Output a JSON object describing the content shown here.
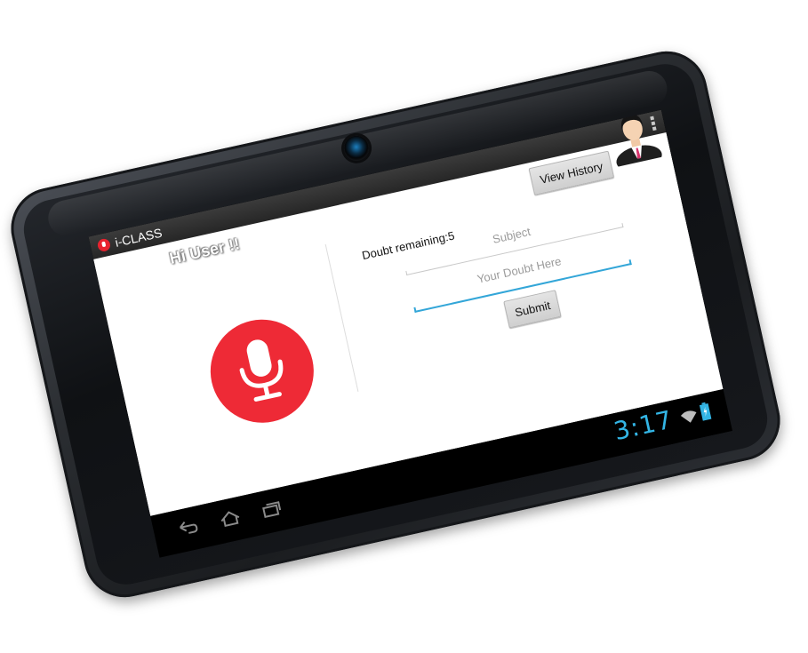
{
  "app": {
    "title": "i-CLASS",
    "icon": "microphone-app-icon",
    "overflow_icon": "overflow-menu-icon"
  },
  "main": {
    "greeting": "Hi User !!",
    "view_history_label": "View History",
    "doubt_remaining": "Doubt remaining:5",
    "subject_placeholder": "Subject",
    "doubt_placeholder": "Your Doubt Here",
    "submit_label": "Submit",
    "mic_icon": "microphone-icon",
    "avatar_icon": "user-avatar-icon"
  },
  "system_bar": {
    "time": "3:17",
    "nav_icons": [
      "back-icon",
      "home-icon",
      "recent-apps-icon"
    ],
    "status_icons": [
      "wifi-icon",
      "battery-icon"
    ]
  },
  "colors": {
    "accent_blue": "#33b5e5",
    "mic_red": "#ee2a36",
    "action_bar": "#2f2f2f"
  }
}
